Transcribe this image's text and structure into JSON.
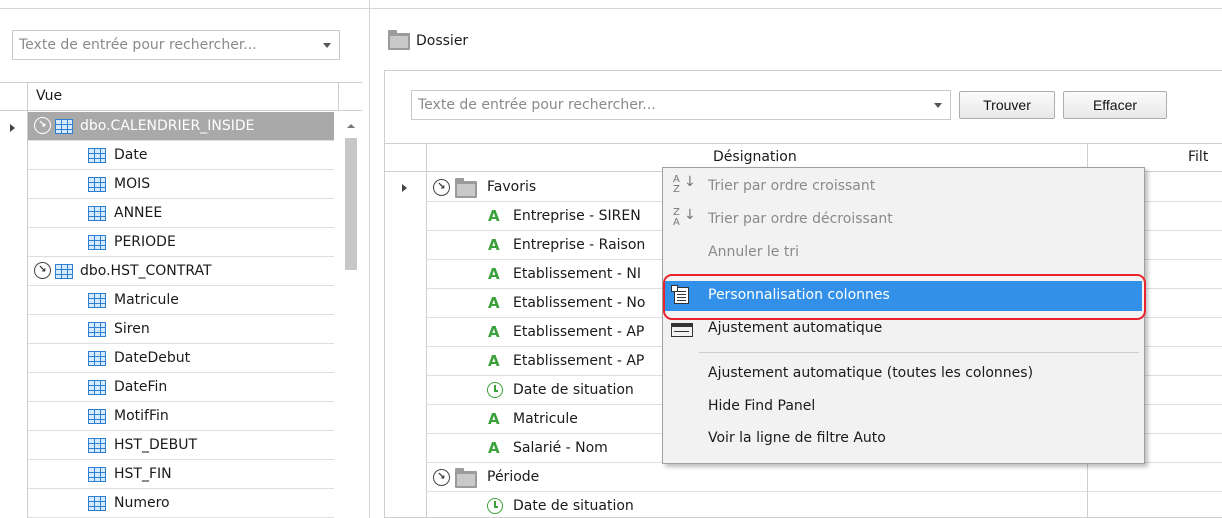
{
  "left_panel": {
    "search_placeholder": "Texte de entrée pour rechercher...",
    "column_header": "Vue",
    "rows": [
      {
        "label": "dbo.CALENDRIER_INSIDE",
        "kind": "group",
        "selected": true
      },
      {
        "label": "Date",
        "kind": "table"
      },
      {
        "label": "MOIS",
        "kind": "table"
      },
      {
        "label": "ANNEE",
        "kind": "table"
      },
      {
        "label": "PERIODE",
        "kind": "table"
      },
      {
        "label": "dbo.HST_CONTRAT",
        "kind": "group"
      },
      {
        "label": "Matricule",
        "kind": "table"
      },
      {
        "label": "Siren",
        "kind": "table"
      },
      {
        "label": "DateDebut",
        "kind": "table"
      },
      {
        "label": "DateFin",
        "kind": "table"
      },
      {
        "label": "MotifFin",
        "kind": "table"
      },
      {
        "label": "HST_DEBUT",
        "kind": "table"
      },
      {
        "label": "HST_FIN",
        "kind": "table"
      },
      {
        "label": "Numero",
        "kind": "table"
      }
    ]
  },
  "right_panel": {
    "title": "Dossier",
    "search_placeholder": "Texte de entrée pour rechercher...",
    "find_button": "Trouver",
    "clear_button": "Effacer",
    "columns": [
      "Désignation",
      "Filt"
    ],
    "rows": [
      {
        "label": "Favoris",
        "kind": "group"
      },
      {
        "label": "Entreprise - SIREN",
        "kind": "text"
      },
      {
        "label": "Entreprise - Raison",
        "kind": "text"
      },
      {
        "label": "Etablissement - NI",
        "kind": "text"
      },
      {
        "label": "Etablissement - No",
        "kind": "text"
      },
      {
        "label": "Etablissement - AP",
        "kind": "text"
      },
      {
        "label": "Etablissement - AP",
        "kind": "text"
      },
      {
        "label": "Date de situation",
        "kind": "date"
      },
      {
        "label": "Matricule",
        "kind": "text"
      },
      {
        "label": "Salarié - Nom",
        "kind": "text"
      },
      {
        "label": "Période",
        "kind": "group"
      },
      {
        "label": "Date de situation",
        "kind": "date"
      }
    ]
  },
  "context_menu": {
    "items": [
      {
        "label": "Trier par ordre croissant",
        "icon": "sort-ascending-icon",
        "disabled": true
      },
      {
        "label": "Trier par ordre décroissant",
        "icon": "sort-descending-icon",
        "disabled": true
      },
      {
        "label": "Annuler le tri",
        "disabled": true
      },
      {
        "label": "Personnalisation colonnes",
        "icon": "column-chooser-icon",
        "highlighted": true
      },
      {
        "label": "Ajustement automatique",
        "icon": "best-fit-icon"
      },
      {
        "label": "Ajustement automatique (toutes les colonnes)"
      },
      {
        "label": "Hide Find Panel"
      },
      {
        "label": "Voir la ligne de filtre Auto"
      }
    ],
    "highlight_color": "#3390e8",
    "callout_color": "#e8232e"
  }
}
